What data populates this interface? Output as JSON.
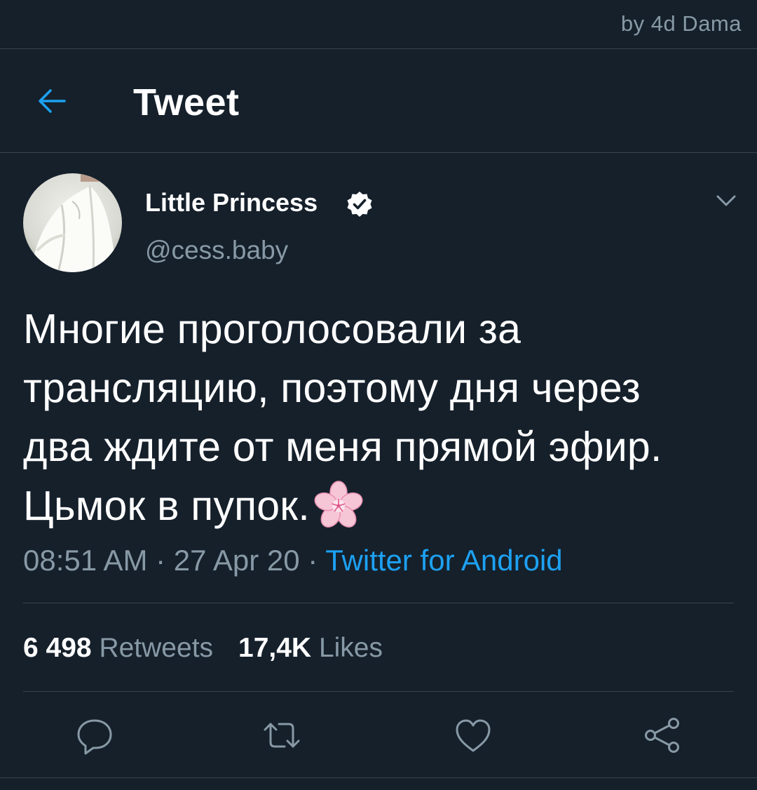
{
  "watermark": "by 4d Dama",
  "header": {
    "title": "Tweet",
    "back_icon": "arrow-left-icon"
  },
  "author": {
    "display_name": "Little Princess",
    "handle": "@cess.baby",
    "verified": true
  },
  "tweet": {
    "text_lines": [
      "Многие проголосовали за",
      "трансляцию, поэтому дня через",
      "два ждите от меня прямой эфир.",
      "Цьмок в пупок."
    ],
    "emoji": "cherry-blossom-icon",
    "time": "08:51 AM",
    "date": "27 Apr 20",
    "separator": " · ",
    "source": "Twitter for Android"
  },
  "stats": {
    "retweets_count": "6 498",
    "retweets_label": "Retweets",
    "likes_count": "17,4K",
    "likes_label": "Likes"
  },
  "actions": [
    "reply-icon",
    "retweet-icon",
    "like-icon",
    "share-icon"
  ],
  "colors": {
    "background": "#15202b",
    "accent": "#1da1f2",
    "secondary_text": "#8899a6",
    "divider": "#38444d"
  }
}
